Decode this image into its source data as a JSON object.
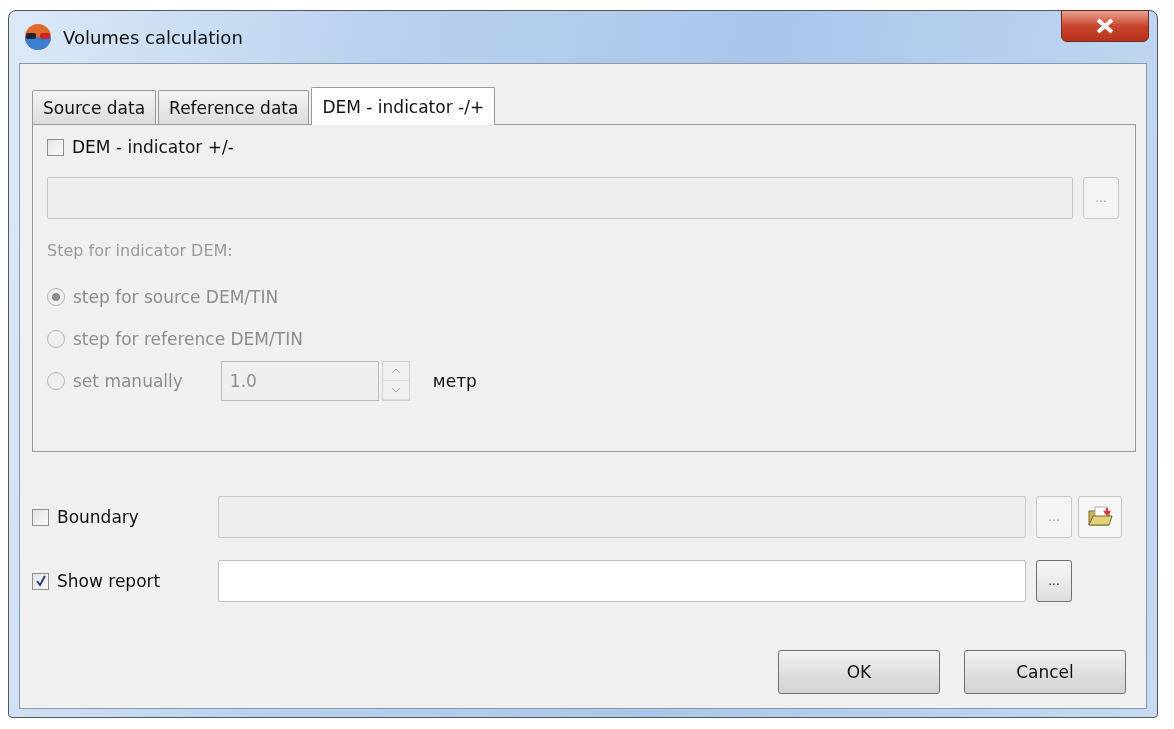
{
  "window": {
    "title": "Volumes calculation"
  },
  "tabs": [
    {
      "label": "Source data",
      "selected": false
    },
    {
      "label": "Reference data",
      "selected": false
    },
    {
      "label": "DEM - indicator -/+",
      "selected": true
    }
  ],
  "indicator": {
    "label": "DEM - indicator +/-",
    "checked": false,
    "disabled": true,
    "browse_button": "...",
    "step_label": "Step for indicator DEM:",
    "step_options": [
      {
        "label": "step for source DEM/TIN",
        "selected": true
      },
      {
        "label": "step for reference DEM/TIN",
        "selected": false
      },
      {
        "label": "set manually",
        "selected": false
      }
    ],
    "manual_value": "1.0",
    "unit": "метр"
  },
  "boundary": {
    "label": "Boundary",
    "checked": false,
    "disabled": true,
    "browse_button": "..."
  },
  "report": {
    "label": "Show report",
    "checked": true,
    "disabled": false,
    "browse_button": "..."
  },
  "buttons": [
    "OK",
    "Cancel"
  ]
}
